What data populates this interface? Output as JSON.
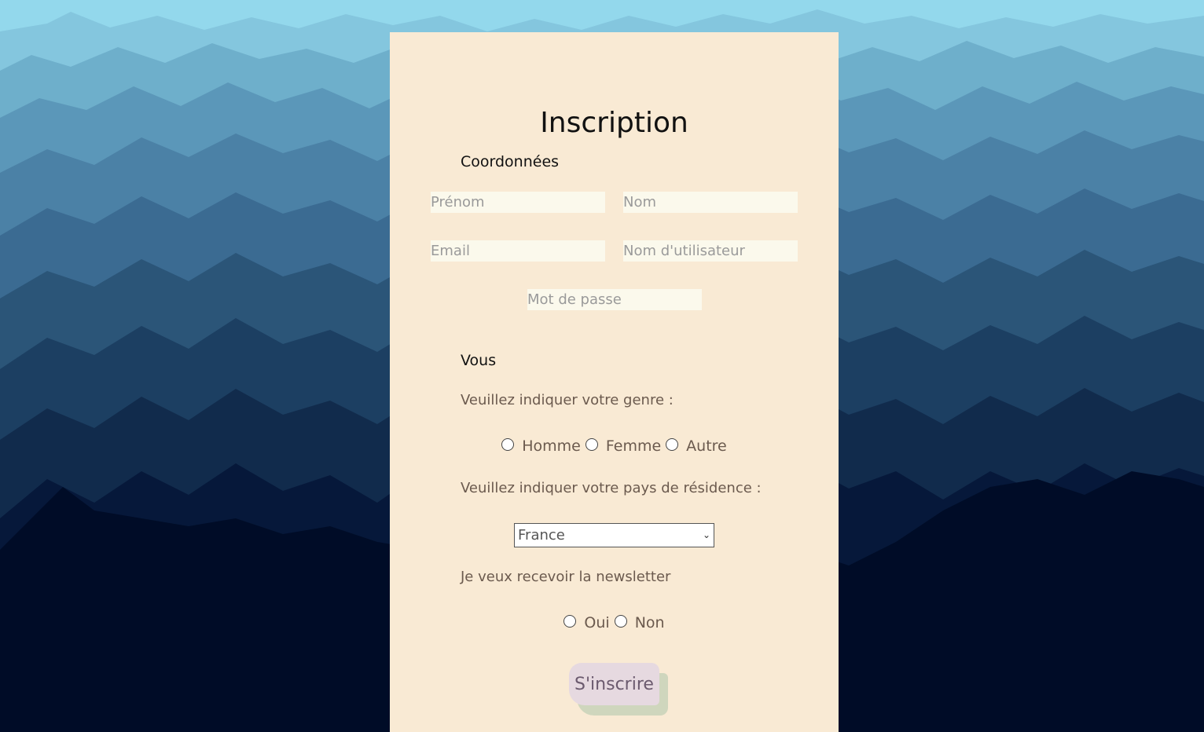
{
  "page": {
    "title": "Inscription"
  },
  "coordonnees": {
    "section_title": "Coordonnées",
    "prenom_placeholder": "Prénom",
    "nom_placeholder": "Nom",
    "email_placeholder": "Email",
    "username_placeholder": "Nom d'utilisateur",
    "password_placeholder": "Mot de passe"
  },
  "vous": {
    "section_title": "Vous",
    "genre_prompt": "Veuillez indiquer votre genre :",
    "genre_options": [
      "Homme",
      "Femme",
      "Autre"
    ],
    "pays_prompt": "Veuillez indiquer votre pays de résidence :",
    "pays_selected": "France",
    "newsletter_prompt": "Je veux recevoir la newsletter",
    "newsletter_options": [
      "Oui",
      "Non"
    ]
  },
  "submit": {
    "label": "S'inscrire"
  },
  "colors": {
    "card_background": "#f9ead4",
    "input_background": "#fbf9ec",
    "button_background": "#e6d9e0",
    "button_shadow": "#cfd6bd"
  }
}
